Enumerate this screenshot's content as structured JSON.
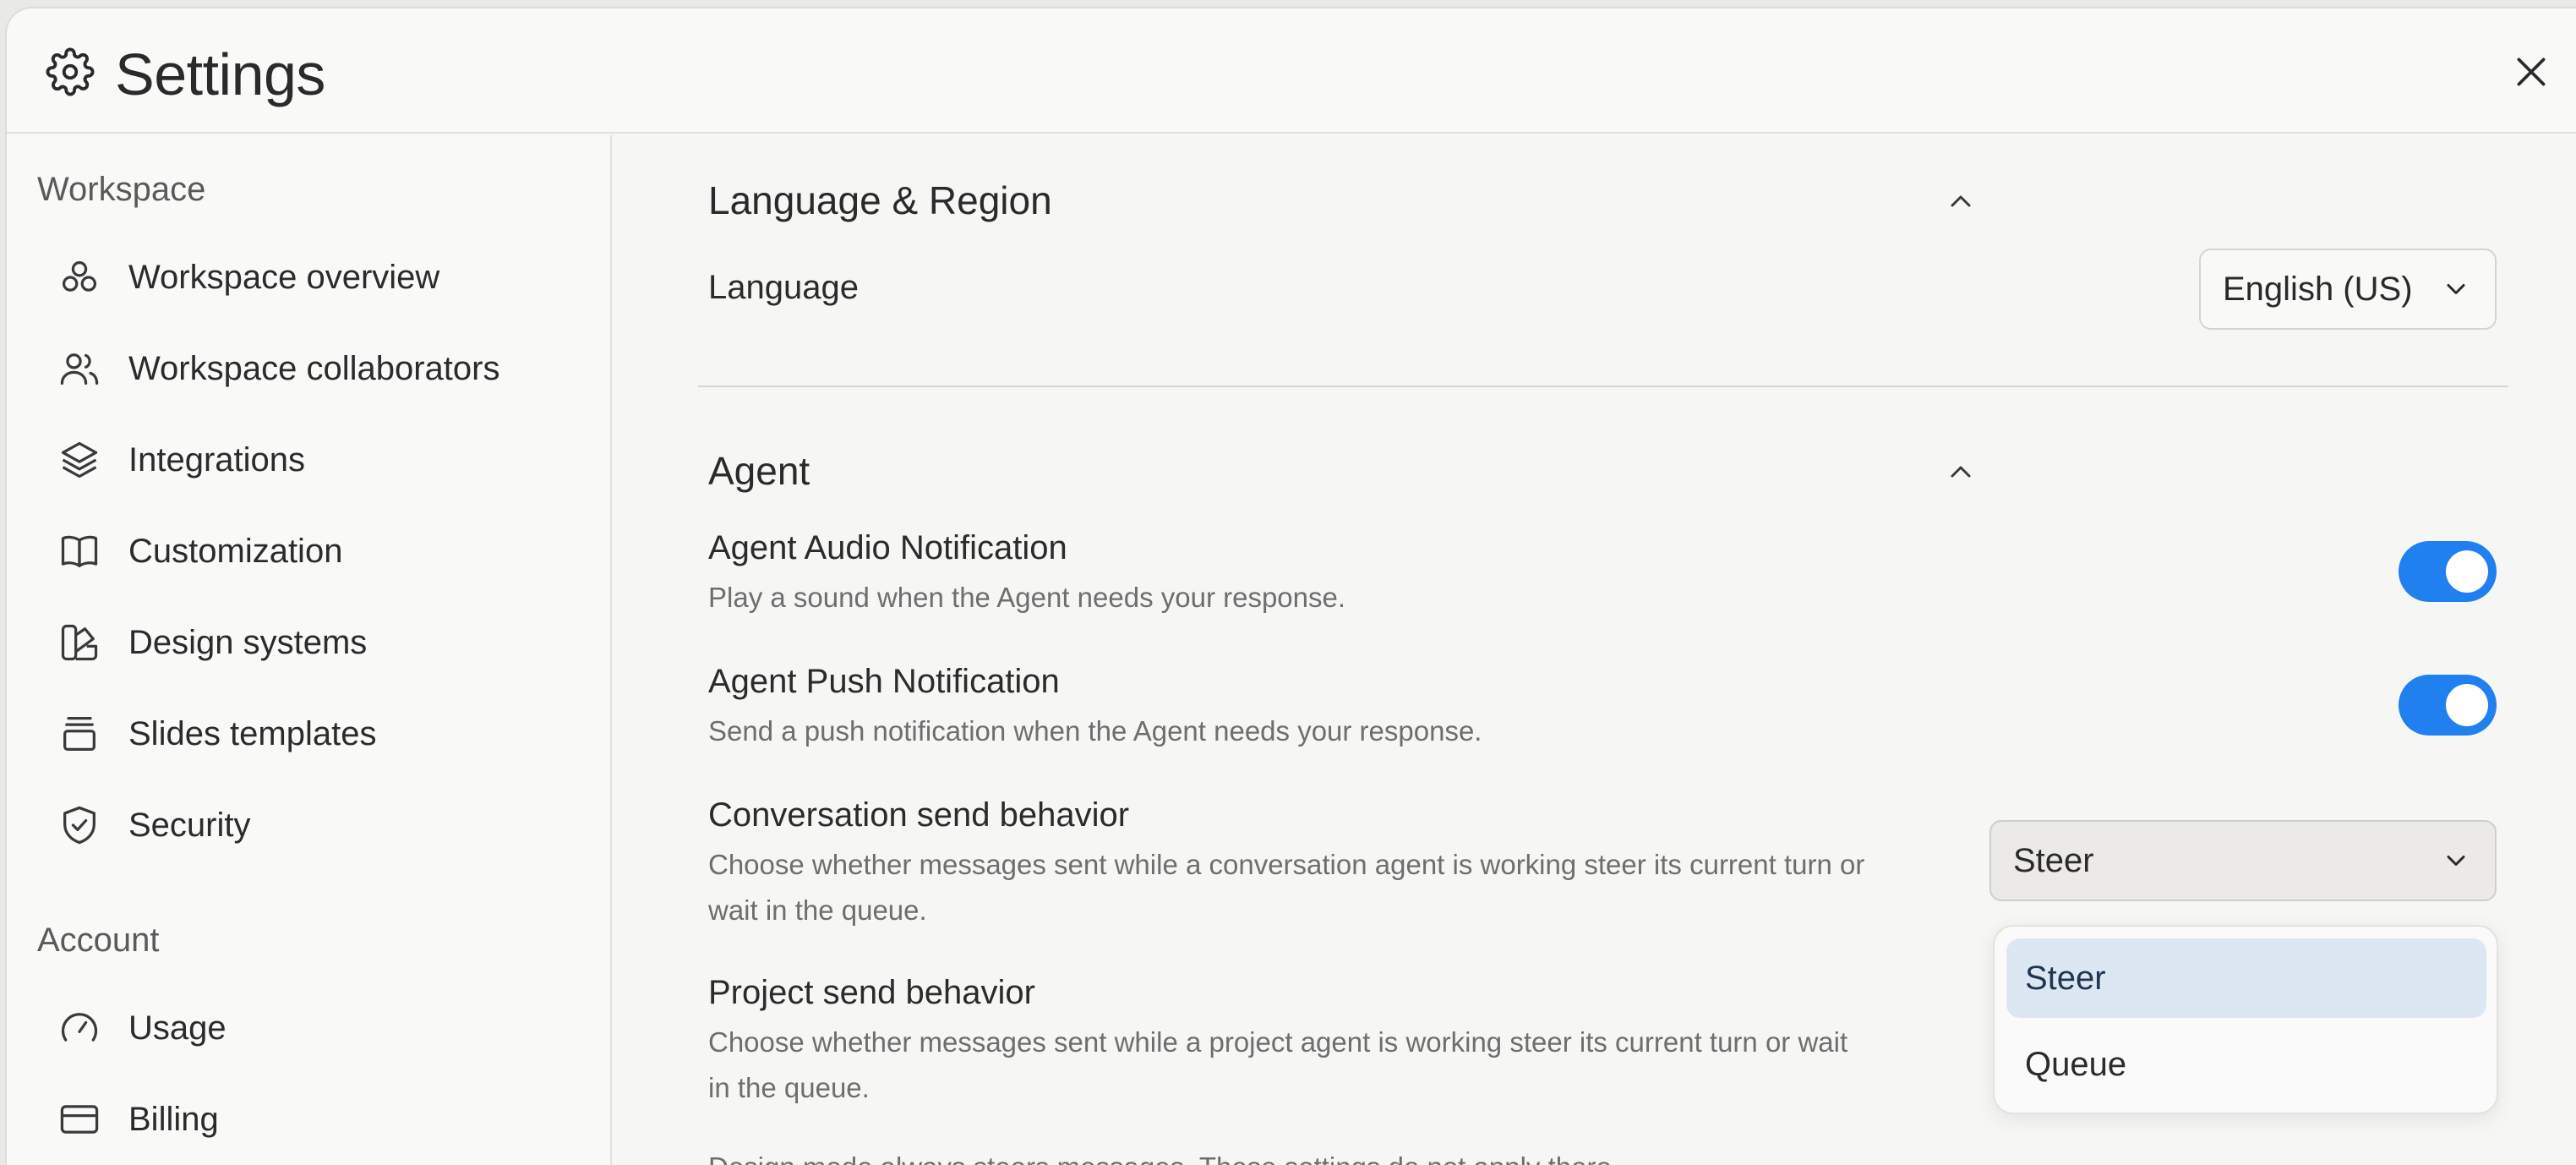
{
  "header": {
    "title": "Settings"
  },
  "sidebar": {
    "sections": [
      {
        "label": "Workspace",
        "items": [
          {
            "label": "Workspace overview",
            "icon": "circles-icon"
          },
          {
            "label": "Workspace collaborators",
            "icon": "users-icon"
          },
          {
            "label": "Integrations",
            "icon": "layers-icon"
          },
          {
            "label": "Customization",
            "icon": "book-icon"
          },
          {
            "label": "Design systems",
            "icon": "swatch-icon"
          },
          {
            "label": "Slides templates",
            "icon": "stack-icon"
          },
          {
            "label": "Security",
            "icon": "shield-icon"
          }
        ]
      },
      {
        "label": "Account",
        "items": [
          {
            "label": "Usage",
            "icon": "gauge-icon"
          },
          {
            "label": "Billing",
            "icon": "card-icon"
          }
        ]
      }
    ]
  },
  "language_region": {
    "title": "Language & Region",
    "language_label": "Language",
    "language_value": "English (US)"
  },
  "agent": {
    "title": "Agent",
    "audio": {
      "label": "Agent Audio Notification",
      "desc": "Play a sound when the Agent needs your response.",
      "enabled": true
    },
    "push": {
      "label": "Agent Push Notification",
      "desc": "Send a push notification when the Agent needs your response.",
      "enabled": true
    },
    "conversation_send": {
      "label": "Conversation send behavior",
      "desc_line1": "Choose whether messages sent while a conversation agent is working steer its current turn or",
      "desc_line2": "wait in the queue.",
      "value": "Steer",
      "options": [
        "Steer",
        "Queue"
      ]
    },
    "project_send": {
      "label": "Project send behavior",
      "desc_line1": "Choose whether messages sent while a project agent is working steer its current turn or wait",
      "desc_line2": "in the queue."
    },
    "footnote": "Design mode always steers messages. These settings do not apply there."
  },
  "colors": {
    "accent": "#2080ef",
    "selected_option": "#dde7f3"
  }
}
